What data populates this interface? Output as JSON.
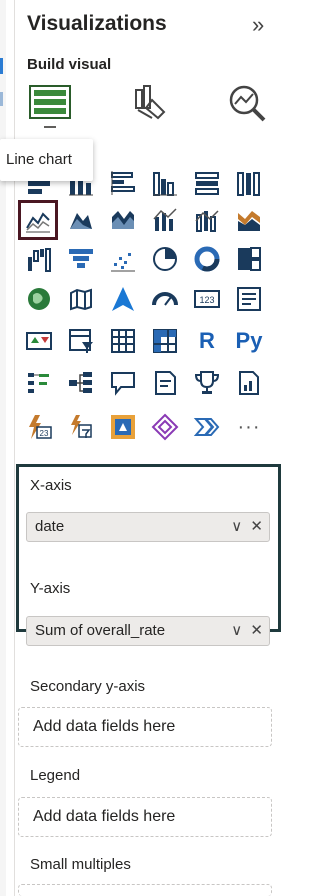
{
  "header": {
    "title": "Visualizations",
    "collapse_icon": "chevron-double-right-icon"
  },
  "build": {
    "label": "Build visual",
    "tabs": [
      {
        "icon": "build-visual-icon",
        "active": true
      },
      {
        "icon": "format-visual-icon",
        "active": false
      },
      {
        "icon": "analytics-icon",
        "active": false
      }
    ]
  },
  "tooltip": {
    "text": "Line chart"
  },
  "visual_icons": [
    [
      "stacked-bar-chart-icon",
      "stacked-column-chart-icon",
      "clustered-bar-chart-icon",
      "clustered-column-chart-icon",
      "100-stacked-bar-chart-icon",
      "100-stacked-column-chart-icon"
    ],
    [
      "line-chart-icon",
      "area-chart-icon",
      "stacked-area-chart-icon",
      "line-and-stacked-column-chart-icon",
      "line-and-clustered-column-chart-icon",
      "ribbon-chart-icon"
    ],
    [
      "waterfall-chart-icon",
      "funnel-icon",
      "scatter-chart-icon",
      "pie-chart-icon",
      "donut-chart-icon",
      "treemap-icon"
    ],
    [
      "map-icon",
      "filled-map-icon",
      "azure-map-icon",
      "gauge-icon",
      "card-icon",
      "multi-row-card-icon"
    ],
    [
      "kpi-icon",
      "slicer-icon",
      "table-icon",
      "matrix-icon",
      "r-visual-icon",
      "python-visual-icon"
    ],
    [
      "key-influencers-icon",
      "decomposition-tree-icon",
      "qa-icon",
      "smart-narrative-icon",
      "goals-icon",
      "paginated-report-icon"
    ],
    [
      "power-apps-icon",
      "power-automate-icon",
      "custom-visual-icon",
      "diamond-visual-icon",
      "chevron-visual-icon",
      "more-visuals-icon"
    ]
  ],
  "wells": {
    "x_axis": {
      "label": "X-axis",
      "field": "date"
    },
    "y_axis": {
      "label": "Y-axis",
      "field": "Sum of overall_rate"
    },
    "secondary_y": {
      "label": "Secondary y-axis",
      "placeholder": "Add data fields here"
    },
    "legend": {
      "label": "Legend",
      "placeholder": "Add data fields here"
    },
    "small_multiples": {
      "label": "Small multiples"
    }
  },
  "pill_actions": {
    "expand": "∨",
    "remove": "✕"
  },
  "r_label": "R",
  "py_label": "Py",
  "more_label": "···"
}
